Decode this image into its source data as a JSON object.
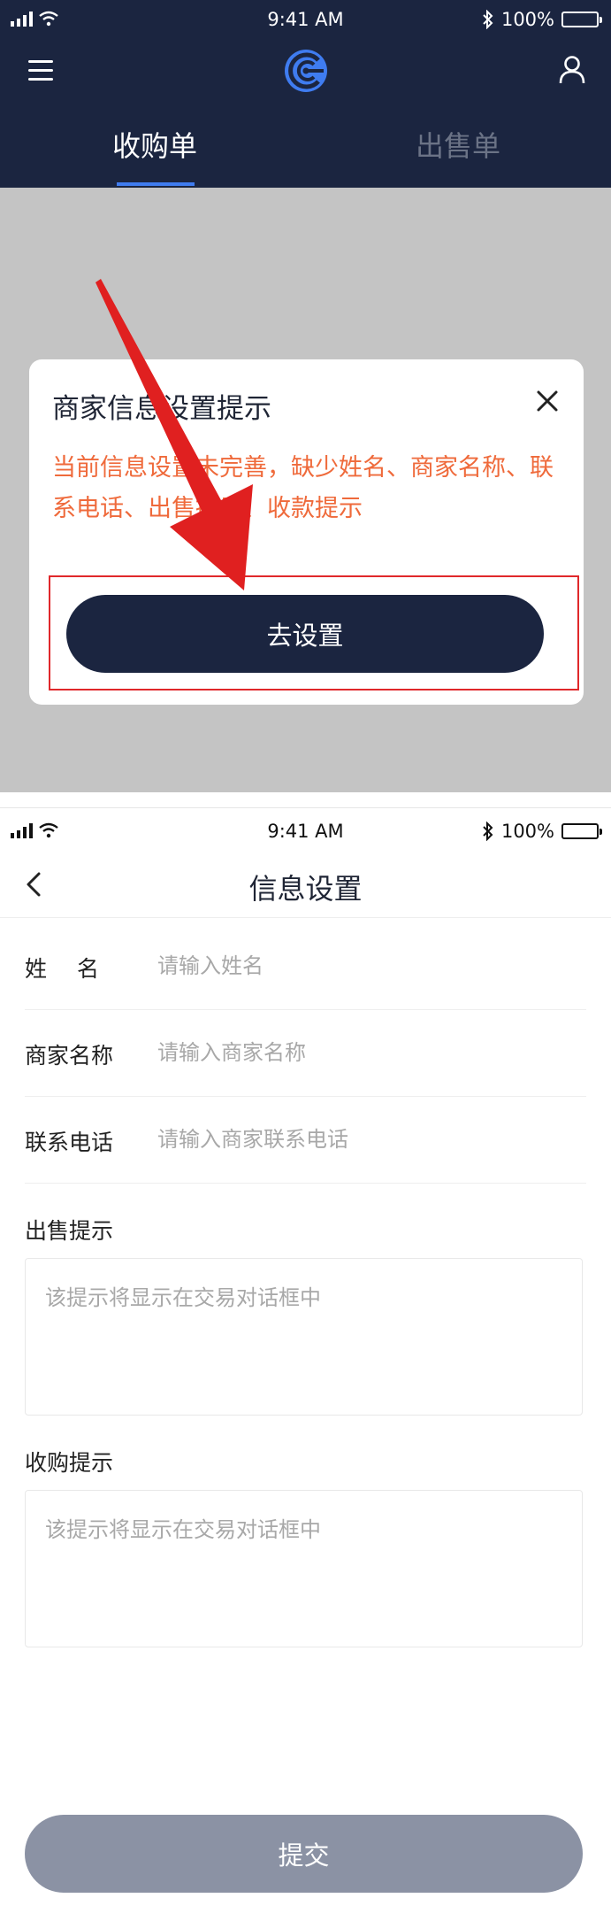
{
  "screen1": {
    "status": {
      "time": "9:41 AM",
      "battery": "100%"
    },
    "tabs": [
      {
        "label": "收购单",
        "active": true
      },
      {
        "label": "出售单",
        "active": false
      }
    ],
    "modal": {
      "title": "商家信息设置提示",
      "message": "当前信息设置未完善，缺少姓名、商家名称、联系电话、出售提示、收款提示",
      "button_label": "去设置"
    },
    "icons": {
      "menu": "hamburger-menu-icon",
      "logo": "brand-logo-icon",
      "user": "user-profile-icon",
      "close": "close-icon",
      "annotation": "red-arrow-annotation"
    },
    "colors": {
      "header_bg": "#1b2540",
      "tab_underline": "#3f7cf0",
      "warning_text": "#ef6a3b",
      "annotation_red": "#e0282b"
    }
  },
  "screen2": {
    "status": {
      "time": "9:41 AM",
      "battery": "100%"
    },
    "title": "信息设置",
    "fields": {
      "name": {
        "label": "姓名",
        "placeholder": "请输入姓名",
        "value": ""
      },
      "merchant": {
        "label": "商家名称",
        "placeholder": "请输入商家名称",
        "value": ""
      },
      "phone": {
        "label": "联系电话",
        "placeholder": "请输入商家联系电话",
        "value": ""
      }
    },
    "sell_tip": {
      "label": "出售提示",
      "placeholder": "该提示将显示在交易对话框中",
      "value": ""
    },
    "buy_tip": {
      "label": "收购提示",
      "placeholder": "该提示将显示在交易对话框中",
      "value": ""
    },
    "submit_label": "提交",
    "icons": {
      "back": "chevron-left-icon"
    },
    "colors": {
      "submit_bg": "#8b92a4",
      "placeholder": "#a8a8a8"
    }
  }
}
